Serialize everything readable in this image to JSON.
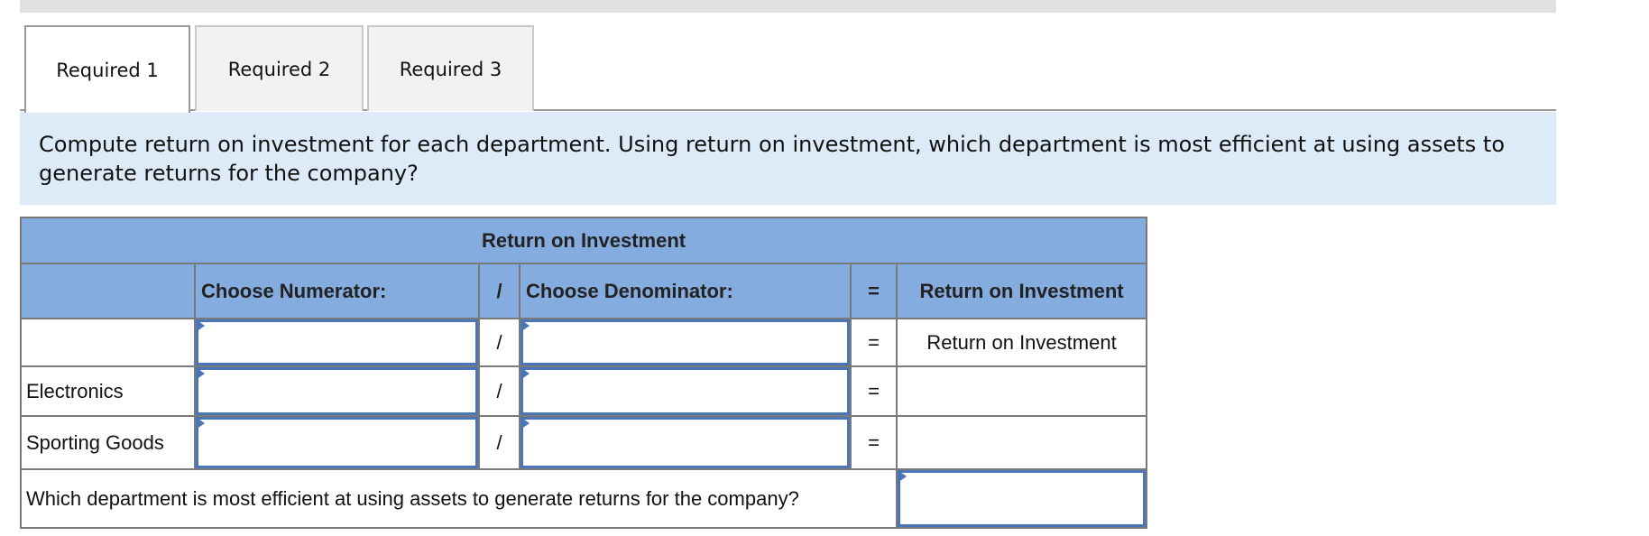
{
  "tabs": [
    {
      "label": "Required 1",
      "active": true
    },
    {
      "label": "Required 2",
      "active": false
    },
    {
      "label": "Required 3",
      "active": false
    }
  ],
  "instruction": "Compute return on investment for each department. Using return on investment, which department is most efficient at using assets to generate returns for the company?",
  "table": {
    "title": "Return on Investment",
    "headers": {
      "row_label": "",
      "numerator": "Choose Numerator:",
      "divide_op": "/",
      "denominator": "Choose Denominator:",
      "equals_op": "=",
      "result": "Return on Investment"
    },
    "rows": [
      {
        "label": "",
        "numerator": "",
        "divide_op": "/",
        "denominator": "",
        "equals_op": "=",
        "result": "Return on Investment"
      },
      {
        "label": "Electronics",
        "numerator": "",
        "divide_op": "/",
        "denominator": "",
        "equals_op": "=",
        "result": ""
      },
      {
        "label": "Sporting Goods",
        "numerator": "",
        "divide_op": "/",
        "denominator": "",
        "equals_op": "=",
        "result": ""
      }
    ],
    "question": {
      "label": "Which department is most efficient at using assets to generate returns for the company?",
      "answer": ""
    }
  },
  "colors": {
    "header_bg": "#84acdf",
    "instruction_bg": "#ddebf8",
    "input_border": "#4a76b8",
    "cell_border": "#7a7a7a"
  }
}
